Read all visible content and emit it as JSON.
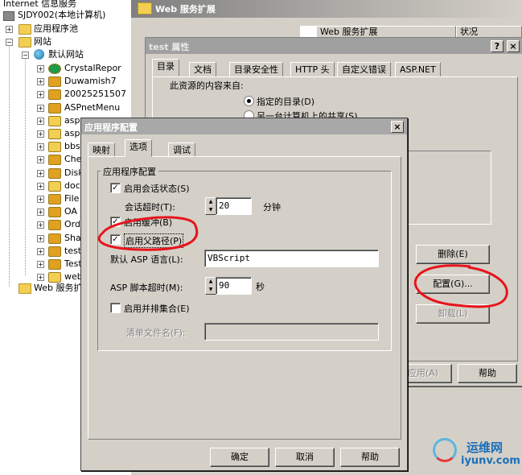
{
  "tree": {
    "root": "Internet 信息服务",
    "computer": "SJDY002(本地计算机)",
    "app_pools": "应用程序池",
    "websites": "网站",
    "default_site": "默认网站",
    "items": [
      "CrystalRepor",
      "Duwamish7",
      "20025251507",
      "ASPnetMenu",
      "asp",
      "asp",
      "bbs",
      "Chec",
      "Disk",
      "doc",
      "File",
      "OA",
      "Orde",
      "Shar",
      "test",
      "Test",
      "web"
    ],
    "web_ext": "Web 服务扩展"
  },
  "main": {
    "header_title": "Web 服务扩展",
    "col_ext": "Web 服务扩展",
    "col_status": "状况"
  },
  "props": {
    "title": "test 属性",
    "help_btn": "?",
    "close_btn": "×",
    "tabs": [
      "目录",
      "文档",
      "目录安全性",
      "HTTP 头",
      "自定义错误",
      "ASP.NET"
    ],
    "content_from": "此资源的内容来自:",
    "radio1": "指定的目录(D)",
    "radio2": "另一台计算机上的共享(S)",
    "remove_btn": "删除(E)",
    "config_btn": "配置(G)...",
    "unload_btn": "卸载(L)",
    "apply_btn": "应用(A)",
    "help_btn2": "帮助"
  },
  "dialog": {
    "title": "应用程序配置",
    "close": "×",
    "tabs": [
      "映射",
      "选项",
      "调试"
    ],
    "group": "应用程序配置",
    "session_state": "启用会话状态(S)",
    "session_timeout_label": "会话超时(T):",
    "session_timeout_value": "20",
    "minutes": "分钟",
    "buffering": "启用缓冲(B)",
    "parent_paths": "启用父路径(P)",
    "asp_lang_label": "默认 ASP 语言(L):",
    "asp_lang_value": "VBScript",
    "asp_timeout_label": "ASP 脚本超时(M):",
    "asp_timeout_value": "90",
    "seconds": "秒",
    "side_by_side": "启用并排集合(E)",
    "manifest_label": "清单文件名(F):",
    "manifest_value": "",
    "ok": "确定",
    "cancel": "取消",
    "help": "帮助"
  },
  "watermark": {
    "line1": "运维网",
    "line2": "iyunv.com"
  },
  "colors": {
    "annotation_red": "#e8141c",
    "title_inactive": "#a0a0a0"
  }
}
